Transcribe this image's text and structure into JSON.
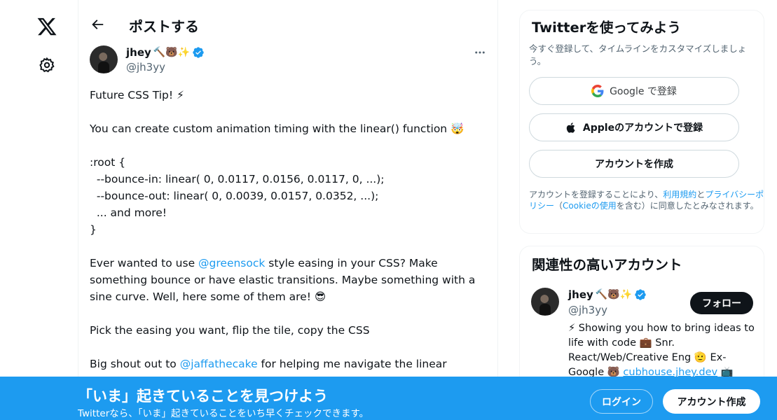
{
  "nav": {
    "logo_icon": "x-logo-icon",
    "settings_icon": "gear-icon"
  },
  "header": {
    "title": "ポストする",
    "back_icon": "arrow-left-icon"
  },
  "tweet": {
    "author_name": "jhey",
    "author_name_emoji": "🔨🐻✨",
    "author_handle": "@jh3yy",
    "lines": [
      "Future CSS Tip! ⚡",
      "",
      "You can create custom animation timing with the linear() function 🤯",
      "",
      ":root {",
      "  --bounce-in: linear( 0, 0.0117, 0.0156, 0.0117, 0, ...);",
      "  --bounce-out: linear( 0, 0.0039, 0.0157, 0.0352, ...);",
      "  ... and more!",
      "}",
      ""
    ],
    "p_greensock_pre": "Ever wanted to use ",
    "p_greensock_link": "@greensock",
    "p_greensock_post": " style easing in your CSS? Make",
    "p_line2": "something bounce or have elastic transitions. Maybe something with a",
    "p_line3": "sine curve. Well, here some of them are! 😎",
    "p_pick": "Pick the easing you want, flip the tile, copy the CSS",
    "p_shout_pre": "Big shout out to ",
    "p_shout_link": "@jaffathecake",
    "p_shout_post": " for helping me navigate the linear"
  },
  "signup": {
    "title": "Twitterを使ってみよう",
    "subtitle": "今すぐ登録して、タイムラインをカスタマイズしましょう。",
    "google_label": "Google で登録",
    "apple_label": "Appleのアカウントで登録",
    "create_label": "アカウントを作成",
    "terms_pre": "アカウントを登録することにより、",
    "terms_link1": "利用規約",
    "terms_mid": "と",
    "terms_link2": "プライバシーポリシー",
    "terms_mid2": "（",
    "terms_link3": "Cookieの使用",
    "terms_post": "を含む）に同意したとみなされます。"
  },
  "related": {
    "title": "関連性の高いアカウント",
    "name": "jhey",
    "name_emoji": "🔨🐻✨",
    "handle": "@jh3yy",
    "follow_label": "フォロー",
    "bio_l1": "⚡ Showing you how to bring ideas to",
    "bio_l2": "life with code 💼 Snr.",
    "bio_l3": "React/Web/Creative Eng 🫡 Ex-",
    "bio_l4_pre": "Google 🐻 ",
    "bio_l4_link": "cubhouse.jhey.dev",
    "bio_l4_post": " 📺"
  },
  "bottom_bar": {
    "title": "「いま」起きていることを見つけよう",
    "subtitle": "Twitterなら、「いま」起きていることをいち早くチェックできます。",
    "login_label": "ログイン",
    "signup_label": "アカウント作成"
  },
  "colors": {
    "accent": "#1d9bf0",
    "text": "#0f1419",
    "muted": "#536471"
  }
}
